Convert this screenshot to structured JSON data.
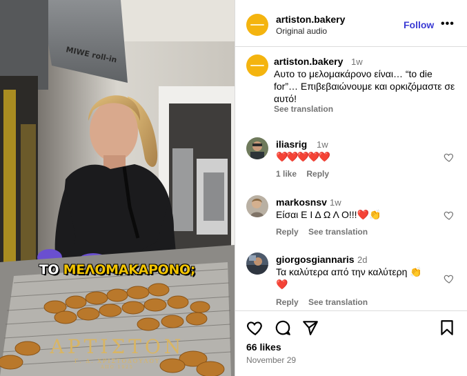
{
  "video": {
    "caption_text": "ΤΟ ",
    "caption_highlight": "ΜΕΛΟΜΑΚΑΡΟΝΟ;",
    "oven_label": "MIWE roll-in",
    "watermark_title": "ΑΡΤΙΣΤΟΝ",
    "watermark_subtitle": "Γ. Δ. ΧΡΙΣΤΟΔΟΥΛΟΥ",
    "watermark_since": "ΑΠΟ 1925"
  },
  "header": {
    "username": "artiston.bakery",
    "audio": "Original audio",
    "follow_label": "Follow",
    "more_label": "•••"
  },
  "caption": {
    "username": "artiston.bakery",
    "time": "1w",
    "text": "Αυτο το μελομακάρονο είναι… “to die for”… Επιβεβαιώνουμε και ορκιζόμαστε σε αυτό!",
    "see_translation": "See translation"
  },
  "comments": [
    {
      "username": "iliasrig",
      "time": "1w",
      "text": "❤️❤️❤️❤️❤️",
      "likes": "1 like",
      "reply": "Reply"
    },
    {
      "username": "markosnsv",
      "time": "1w",
      "text_main": "Είσαι Ε Ι Δ Ω Λ Ο!!!",
      "text_heart": "❤️",
      "text_clap": "👏",
      "reply": "Reply",
      "see_translation": "See translation"
    },
    {
      "username": "giorgosgiannaris",
      "time": "2d",
      "text_main": "Τα καλύτερα από την καλύτερη ",
      "text_clap": "👏",
      "text_heart": "❤️",
      "reply": "Reply",
      "see_translation": "See translation"
    }
  ],
  "footer": {
    "likes": "66 likes",
    "date": "November 29"
  },
  "colors": {
    "brand_yellow": "#f4b40f",
    "follow_blue": "#3b3bd4",
    "secondary_text": "#737373"
  },
  "icons": [
    "like-icon",
    "comment-icon",
    "share-icon",
    "save-icon",
    "heart-outline-icon",
    "more-icon"
  ]
}
